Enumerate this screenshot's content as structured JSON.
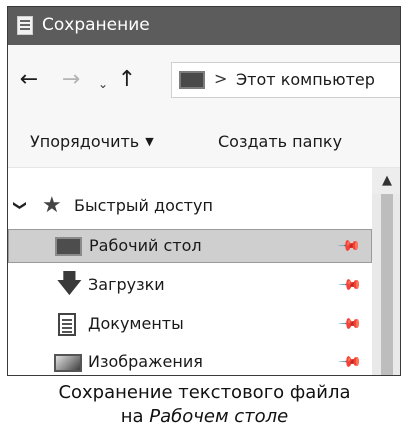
{
  "window": {
    "title": "Сохранение"
  },
  "address_bar": {
    "path_separator": ">",
    "location": "Этот компьютер"
  },
  "toolbar": {
    "organize_label": "Упорядочить",
    "new_folder_label": "Создать папку"
  },
  "navigation": {
    "quick_access": {
      "label": "Быстрый доступ",
      "expanded": true
    },
    "items": [
      {
        "label": "Рабочий стол",
        "icon": "desktop-icon",
        "pinned": true,
        "selected": true
      },
      {
        "label": "Загрузки",
        "icon": "download-arrow-icon",
        "pinned": true,
        "selected": false
      },
      {
        "label": "Документы",
        "icon": "document-icon",
        "pinned": true,
        "selected": false
      },
      {
        "label": "Изображения",
        "icon": "picture-icon",
        "pinned": true,
        "selected": false
      }
    ]
  },
  "caption": {
    "line1": "Сохранение текстового файла",
    "line2_prefix": "на ",
    "line2_italic": "Рабочем столе"
  },
  "colors": {
    "titlebar": "#5c5c5c",
    "selection": "#cfcfcf"
  }
}
